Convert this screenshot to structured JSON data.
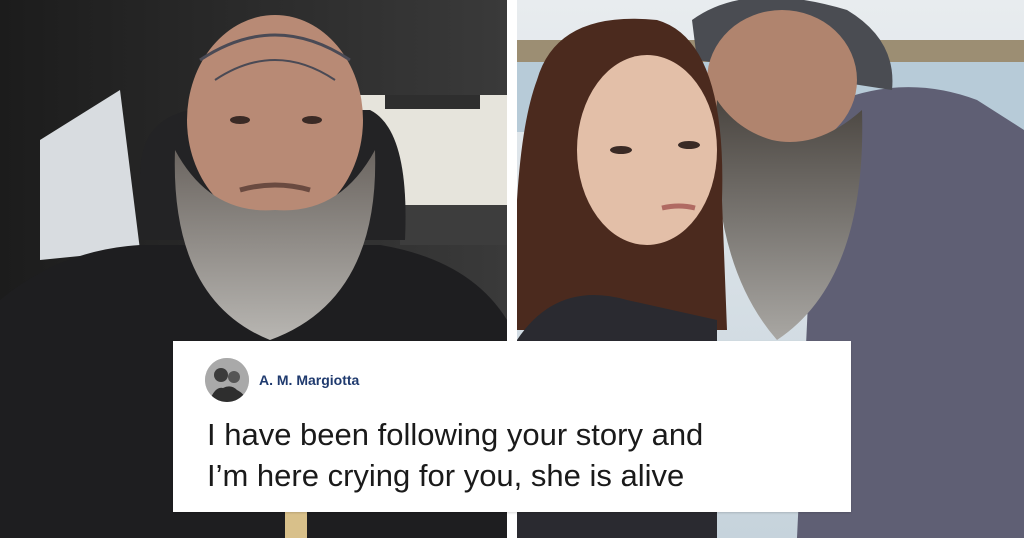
{
  "comment": {
    "author": "A. M. Margiotta",
    "lines": [
      "I have been following your story and",
      "I’m here crying for you, she is alive"
    ]
  },
  "colors": {
    "author": "#1f3a6e",
    "text": "#1a1a1a",
    "card": "#ffffff"
  }
}
